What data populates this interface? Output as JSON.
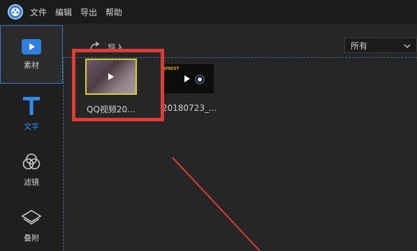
{
  "menubar": {
    "items": [
      "文件",
      "编辑",
      "导出",
      "帮助"
    ]
  },
  "sidebar": {
    "items": [
      {
        "label": "素材",
        "icon": "media-play-icon"
      },
      {
        "label": "文字",
        "icon": "text-t-icon"
      },
      {
        "label": "滤镜",
        "icon": "filter-circles-icon"
      },
      {
        "label": "叠附",
        "icon": "overlay-layers-icon"
      }
    ]
  },
  "content": {
    "import_label": "导入",
    "filter_value": "所有",
    "media": [
      {
        "label": "QQ视频20..."
      },
      {
        "label": "20180723_..."
      }
    ],
    "thumb2_tag": "FUNEST"
  },
  "colors": {
    "accent": "#3a78c8",
    "highlight": "#e03c35",
    "selected_border": "#d9cf3a"
  }
}
